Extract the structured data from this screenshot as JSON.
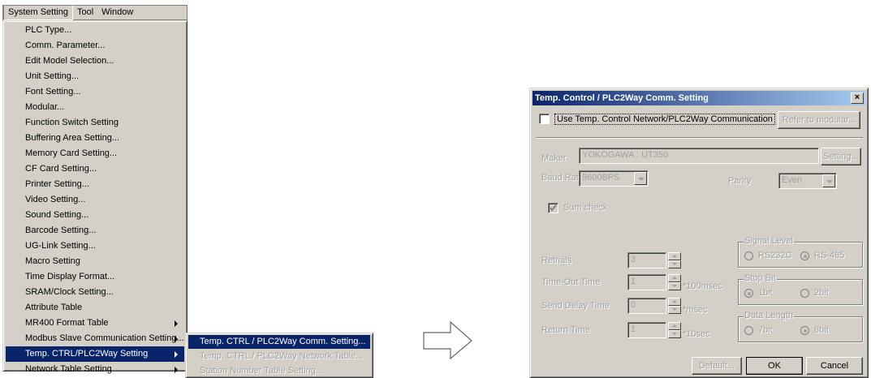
{
  "menubar": {
    "items": [
      "System Setting",
      "Tool",
      "Window"
    ]
  },
  "main_menu": {
    "items": [
      {
        "label": "PLC Type..."
      },
      {
        "label": "Comm. Parameter..."
      },
      {
        "label": "Edit Model Selection..."
      },
      {
        "label": "Unit Setting..."
      },
      {
        "label": "Font Setting..."
      },
      {
        "label": "Modular..."
      },
      {
        "label": "Function Switch Setting"
      },
      {
        "label": "Buffering Area Setting..."
      },
      {
        "label": "Memory Card Setting..."
      },
      {
        "label": "CF Card Setting..."
      },
      {
        "label": "Printer Setting..."
      },
      {
        "label": "Video Setting..."
      },
      {
        "label": "Sound Setting..."
      },
      {
        "label": "Barcode Setting..."
      },
      {
        "label": "UG-Link Setting..."
      },
      {
        "label": "Macro Setting"
      },
      {
        "label": "Time Display Format..."
      },
      {
        "label": "SRAM/Clock Setting..."
      },
      {
        "label": "Attribute Table"
      },
      {
        "label": "MR400 Format Table"
      },
      {
        "label": "Modbus Slave Communication Setting..."
      },
      {
        "label": "Temp. CTRL/PLC2Way Setting"
      },
      {
        "label": "Network Table Setting"
      }
    ]
  },
  "sub_menu": {
    "items": [
      {
        "label": "Temp. CTRL / PLC2Way Comm. Setting..."
      },
      {
        "label": "Temp. CTRL / PLC2Way Network Table..."
      },
      {
        "label": "Station Number Table Setting..."
      }
    ]
  },
  "dialog": {
    "title": "Temp. Control / PLC2Way Comm. Setting",
    "close_glyph": "×",
    "use_network_label": "Use Temp. Control Network/PLC2Way Communication",
    "refer_button": "Refer to modular...",
    "maker_label": "Maker",
    "maker_value": "YOKOGAWA : UT350",
    "setting_button": "Setting...",
    "baud_label": "Baud Rate",
    "baud_value": "9600BPS",
    "parity_label": "Parity",
    "parity_value": "Even",
    "sum_check_label": "Sum check",
    "retrials_label": "Retrials",
    "retrials_value": "3",
    "timeout_label": "Time-Out Time",
    "timeout_value": "1",
    "timeout_unit": "*100msec",
    "send_delay_label": "Send Delay Time",
    "send_delay_value": "0",
    "send_delay_unit": "*msec",
    "return_label": "Return Time",
    "return_value": "1",
    "return_unit": "*10sec",
    "signal_level_title": "Signal Level",
    "rs232c": "RS232C",
    "rs485": "RS-485",
    "stop_bit_title": "Stop Bit",
    "bit1": "1bit",
    "bit2": "2bit",
    "data_length_title": "Data Length",
    "bit7": "7bit",
    "bit8": "8bit",
    "default_button": "Default...",
    "ok_button": "OK",
    "cancel_button": "Cancel"
  },
  "colors": {
    "menu_bg": "#d4d0c8",
    "selection": "#0a246a",
    "disabled_text": "#a0a0a0"
  }
}
